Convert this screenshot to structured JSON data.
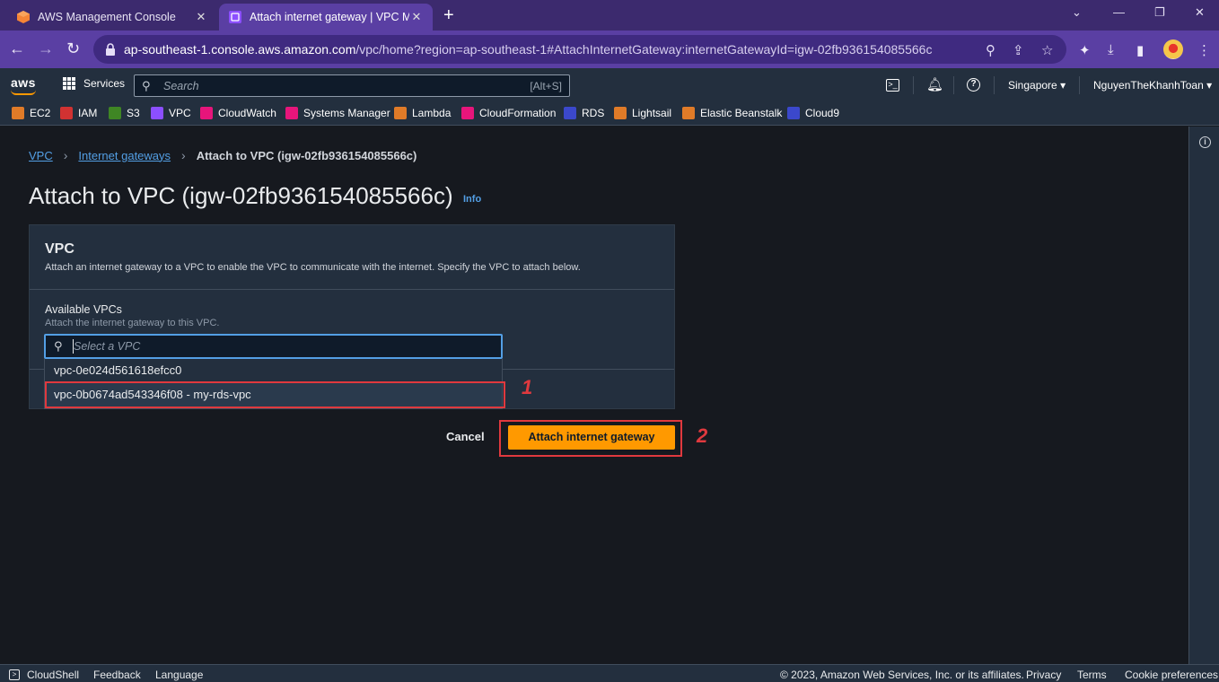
{
  "browser": {
    "tabs": [
      {
        "title": "AWS Management Console",
        "active": false
      },
      {
        "title": "Attach internet gateway | VPC Ma",
        "active": true
      }
    ],
    "url_host": "ap-southeast-1.console.aws.amazon.com",
    "url_path": "/vpc/home?region=ap-southeast-1#AttachInternetGateway:internetGatewayId=igw-02fb936154085566c"
  },
  "aws_header": {
    "logo": "aws",
    "services_label": "Services",
    "search_placeholder": "Search",
    "search_shortcut": "[Alt+S]",
    "region": "Singapore",
    "user": "NguyenTheKhanhToan"
  },
  "favorites": [
    {
      "label": "EC2",
      "color": "#e07b28"
    },
    {
      "label": "IAM",
      "color": "#d13232"
    },
    {
      "label": "S3",
      "color": "#3f8624"
    },
    {
      "label": "VPC",
      "color": "#8c4fff"
    },
    {
      "label": "CloudWatch",
      "color": "#e7157b"
    },
    {
      "label": "Systems Manager",
      "color": "#e7157b"
    },
    {
      "label": "Lambda",
      "color": "#e07b28"
    },
    {
      "label": "CloudFormation",
      "color": "#e7157b"
    },
    {
      "label": "RDS",
      "color": "#3b48cc"
    },
    {
      "label": "Lightsail",
      "color": "#e07b28"
    },
    {
      "label": "Elastic Beanstalk",
      "color": "#e07b28"
    },
    {
      "label": "Cloud9",
      "color": "#3b48cc"
    }
  ],
  "breadcrumb": {
    "items": [
      "VPC",
      "Internet gateways"
    ],
    "current": "Attach to VPC (igw-02fb936154085566c)"
  },
  "page": {
    "title": "Attach to VPC (igw-02fb936154085566c)",
    "info_link": "Info"
  },
  "panel": {
    "heading": "VPC",
    "description": "Attach an internet gateway to a VPC to enable the VPC to communicate with the internet. Specify the VPC to attach below.",
    "field_label": "Available VPCs",
    "field_hint": "Attach the internet gateway to this VPC.",
    "select_placeholder": "Select a VPC",
    "options": [
      "vpc-0e024d561618efcc0",
      "vpc-0b0674ad543346f08 - my-rds-vpc"
    ]
  },
  "actions": {
    "cancel": "Cancel",
    "attach": "Attach internet gateway"
  },
  "annotations": [
    "1",
    "2"
  ],
  "footer": {
    "cloudshell": "CloudShell",
    "feedback": "Feedback",
    "language": "Language",
    "copyright": "© 2023, Amazon Web Services, Inc. or its affiliates.",
    "privacy": "Privacy",
    "terms": "Terms",
    "cookies": "Cookie preferences"
  }
}
